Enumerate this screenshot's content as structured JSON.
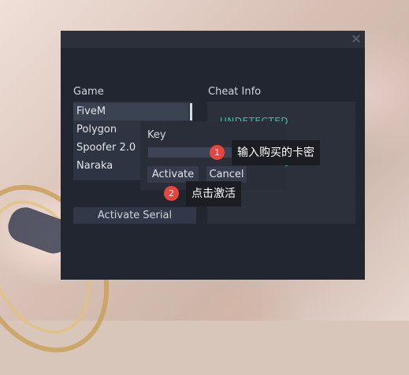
{
  "window": {
    "close_icon": "close-icon"
  },
  "labels": {
    "game": "Game",
    "cheat_info": "Cheat Info",
    "key": "Key"
  },
  "games": [
    "FiveM",
    "Polygon",
    "Spoofer 2.0",
    "Naraka"
  ],
  "cheat_info": {
    "status": "UNDETECTED",
    "status_tail": "S",
    "status_color": "#2fc7a7"
  },
  "buttons": {
    "activate_serial": "Activate Serial",
    "activate": "Activate",
    "cancel": "Cancel"
  },
  "key_input": {
    "value": ""
  },
  "annotations": [
    {
      "number": "1",
      "text": "输入购买的卡密"
    },
    {
      "number": "2",
      "text": "点击激活"
    }
  ]
}
